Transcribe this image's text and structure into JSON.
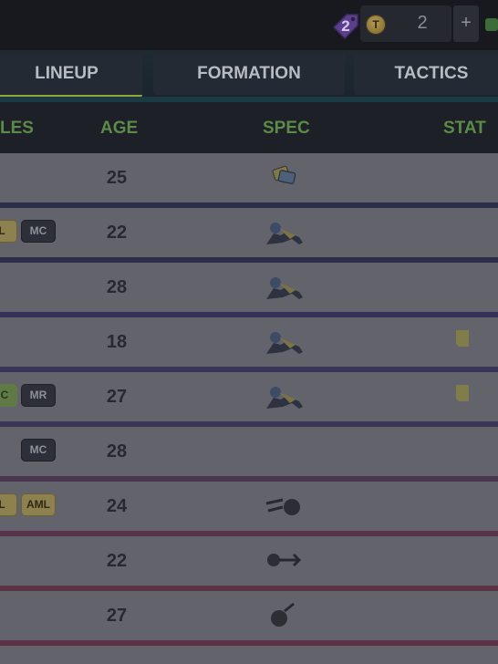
{
  "currency": {
    "tag_count": "2",
    "coin_letter": "T",
    "coin_count": "2",
    "plus_label": "+"
  },
  "tabs": [
    {
      "label": "LINEUP",
      "active": true
    },
    {
      "label": "FORMATION",
      "active": false
    },
    {
      "label": "TACTICS",
      "active": false
    }
  ],
  "table": {
    "headers": {
      "roles": "LES",
      "age": "AGE",
      "spec": "SPEC",
      "stat": "STAT"
    },
    "rows": [
      {
        "age": "25",
        "roles": [],
        "spec": "cards-icon",
        "stat": false
      },
      {
        "age": "22",
        "roles": [
          {
            "label": "ML",
            "style": "yellow"
          },
          {
            "label": "MC",
            "style": "dark"
          }
        ],
        "spec": "player-kick-icon",
        "stat": false
      },
      {
        "age": "28",
        "roles": [],
        "spec": "player-kick-icon",
        "stat": false
      },
      {
        "age": "18",
        "roles": [],
        "spec": "player-kick-icon",
        "stat": true
      },
      {
        "age": "27",
        "roles": [
          {
            "label": "MC",
            "style": "green"
          },
          {
            "label": "MR",
            "style": "dark"
          }
        ],
        "spec": "player-kick-icon",
        "stat": true
      },
      {
        "age": "28",
        "roles": [
          {
            "label": "MC",
            "style": "dark"
          }
        ],
        "spec": "",
        "stat": false
      },
      {
        "age": "24",
        "roles": [
          {
            "label": "ML",
            "style": "yellow"
          },
          {
            "label": "AML",
            "style": "yellow"
          }
        ],
        "spec": "ball-dribble-icon",
        "stat": false
      },
      {
        "age": "22",
        "roles": [],
        "spec": "ball-pass-icon",
        "stat": false
      },
      {
        "age": "27",
        "roles": [],
        "spec": "bomb-shot-icon",
        "stat": false
      }
    ]
  }
}
